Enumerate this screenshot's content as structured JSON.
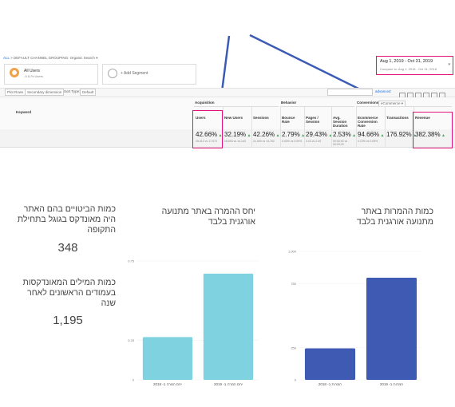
{
  "ga": {
    "view_label": "ALL",
    "breadcrumb": "DEFAULT CHANNEL GROUPING: Organic Search",
    "segment1": {
      "title": "All Users",
      "sub": "-9.11% Users"
    },
    "segment2": "+ Add Segment",
    "date_range": "Aug 1, 2019 - Oct 31, 2019",
    "compare_label": "Compare to:",
    "compare_range": "Aug 1, 2018 - Oct 31, 2018",
    "plot_rows": "Plot Rows",
    "secondary_dimension": "Secondary dimension",
    "sort_type": "Sort Type:",
    "sort_value": "Default",
    "advanced": "advanced",
    "keyword_header": "Keyword",
    "groups": {
      "acquisition": "Acquisition",
      "behavior": "Behavior",
      "conversions": "Conversions",
      "ecommerce": "eCommerce"
    },
    "columns": [
      "Users",
      "New Users",
      "Sessions",
      "Bounce Rate",
      "Pages / Session",
      "Avg. Session Duration",
      "Ecommerce Conversion Rate",
      "Transactions",
      "Revenue"
    ],
    "values": [
      "42.66%",
      "32.19%",
      "42.26%",
      "2.79%",
      "29.43%",
      "2.53%",
      "94.66%",
      "176.92%",
      "382.38%"
    ],
    "subs": [
      "25,012 vs 17,573",
      "18,694 vs 14,143",
      "21,000 vs 14,762",
      "0.00% vs 0.00%",
      "3.23 vs 2.49",
      "00:03:40 vs 00:03:23",
      "0.19% vs 0.05%",
      "",
      ""
    ]
  },
  "left": {
    "caption1": "כמות הביטויים בהם האתר היה מאונדקס בגוגל בתחילת התקופה",
    "value1": "348",
    "caption2": "כמות המילים המאונדקסות בעמודים הראשונים לאחר שנה",
    "value2": "1,195"
  },
  "mid_caption": "יחס ההמרה באתר מתנועה אורגנית בלבד",
  "right_caption": "כמות ההמרות באתר מתנועה אורגנית בלבד",
  "colors": {
    "teal": "#7fd3e0",
    "blue": "#3f5ab3",
    "pink": "#e0157a",
    "arrow": "#3c5bb4",
    "green": "#3aa84c"
  },
  "chart_data": [
    {
      "type": "bar",
      "title": "יחס ההמרה באתר מתנועה אורגנית בלבד",
      "categories": [
        "יחס המרה ב- 2018",
        "יחס המרה ב- 2019"
      ],
      "values": [
        0.27,
        0.67
      ],
      "yticks": [
        "0",
        "0.25",
        "0.75"
      ],
      "ylim": [
        0,
        0.75
      ]
    },
    {
      "type": "bar",
      "title": "כמות ההמרות באתר מתנועה אורגנית בלבד",
      "categories": [
        "המרות ב- 2018",
        "המרות ב- 2019"
      ],
      "values": [
        245,
        795
      ],
      "yticks": [
        "0",
        "250",
        "750",
        "1,000"
      ],
      "ylim": [
        0,
        1000
      ]
    }
  ]
}
